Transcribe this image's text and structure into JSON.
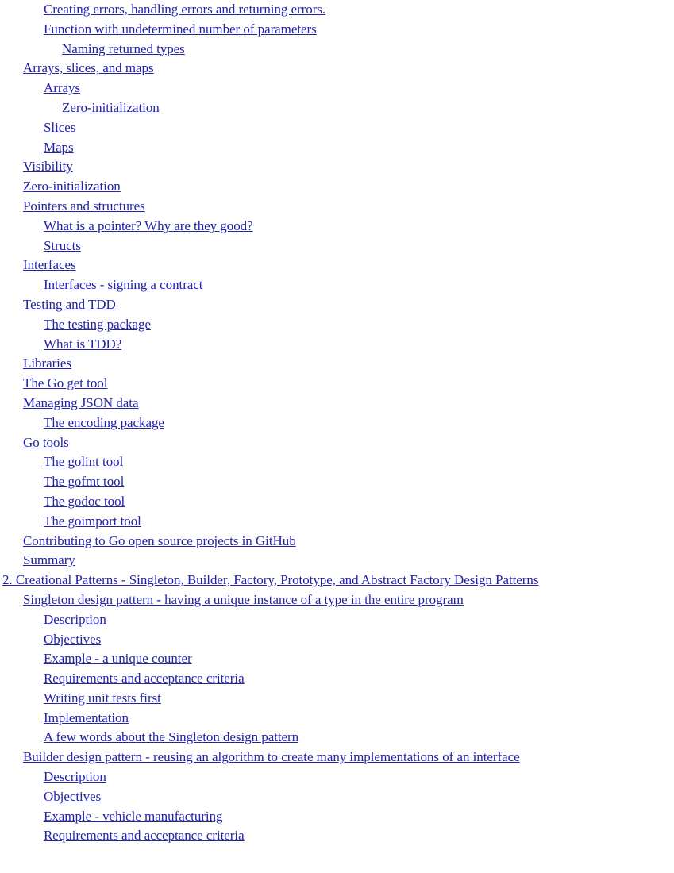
{
  "document": {
    "kind": "table-of-contents",
    "link_color": "#2222aa",
    "background_color": "#ffffff"
  },
  "entries": [
    {
      "label": "Creating errors, handling errors and returning errors.",
      "level": 2
    },
    {
      "label": "Function with undetermined number of parameters",
      "level": 2
    },
    {
      "label": "Naming returned types",
      "level": 3
    },
    {
      "label": "Arrays, slices, and maps",
      "level": 1
    },
    {
      "label": "Arrays",
      "level": 2
    },
    {
      "label": "Zero-initialization",
      "level": 3
    },
    {
      "label": "Slices",
      "level": 2
    },
    {
      "label": "Maps",
      "level": 2
    },
    {
      "label": "Visibility",
      "level": 1
    },
    {
      "label": "Zero-initialization",
      "level": 1
    },
    {
      "label": "Pointers and structures",
      "level": 1
    },
    {
      "label": "What is a pointer? Why are they good?",
      "level": 2
    },
    {
      "label": "Structs",
      "level": 2
    },
    {
      "label": "Interfaces",
      "level": 1
    },
    {
      "label": "Interfaces - signing a contract",
      "level": 2
    },
    {
      "label": "Testing and TDD",
      "level": 1
    },
    {
      "label": "The testing package",
      "level": 2
    },
    {
      "label": "What is TDD?",
      "level": 2
    },
    {
      "label": "Libraries",
      "level": 1
    },
    {
      "label": "The Go get tool",
      "level": 1
    },
    {
      "label": "Managing JSON data",
      "level": 1
    },
    {
      "label": "The encoding package",
      "level": 2
    },
    {
      "label": "Go tools",
      "level": 1
    },
    {
      "label": "The golint tool",
      "level": 2
    },
    {
      "label": "The gofmt tool",
      "level": 2
    },
    {
      "label": "The godoc tool",
      "level": 2
    },
    {
      "label": "The goimport tool",
      "level": 2
    },
    {
      "label": "Contributing to Go open source projects in GitHub",
      "level": 1
    },
    {
      "label": "Summary",
      "level": 1
    },
    {
      "label": "2. Creational Patterns - Singleton, Builder, Factory, Prototype, and Abstract Factory Design Patterns",
      "level": 0
    },
    {
      "label": "Singleton design pattern - having a unique instance of a type in the entire program",
      "level": 1
    },
    {
      "label": "Description",
      "level": 2
    },
    {
      "label": "Objectives",
      "level": 2
    },
    {
      "label": "Example - a unique counter",
      "level": 2
    },
    {
      "label": "Requirements and acceptance criteria",
      "level": 2
    },
    {
      "label": "Writing unit tests first",
      "level": 2
    },
    {
      "label": "Implementation",
      "level": 2
    },
    {
      "label": "A few words about the Singleton design pattern",
      "level": 2
    },
    {
      "label": "Builder design pattern - reusing an algorithm to create many implementations of an interface",
      "level": 1
    },
    {
      "label": "Description",
      "level": 2
    },
    {
      "label": "Objectives",
      "level": 2
    },
    {
      "label": "Example - vehicle manufacturing",
      "level": 2
    },
    {
      "label": "Requirements and acceptance criteria",
      "level": 2
    }
  ]
}
